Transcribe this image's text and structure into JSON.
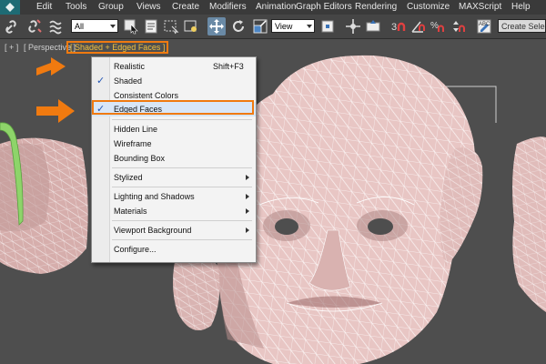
{
  "menubar": {
    "items": [
      "Edit",
      "Tools",
      "Group",
      "Views",
      "Create",
      "Modifiers",
      "Animation",
      "Graph Editors",
      "Rendering",
      "Customize",
      "MAXScript",
      "Help"
    ]
  },
  "toolbar": {
    "filter_value": "All",
    "view_value": "View",
    "search_placeholder": "Create Selection Set"
  },
  "viewport": {
    "label_plus": "[ + ]",
    "label_view": "[ Perspective ]",
    "label_shading": "[ Shaded + Edged Faces ]"
  },
  "context_menu": {
    "items": [
      {
        "label": "Realistic",
        "shortcut": "Shift+F3",
        "checked": false,
        "submenu": false
      },
      {
        "label": "Shaded",
        "shortcut": "",
        "checked": true,
        "submenu": false
      },
      {
        "label": "Consistent Colors",
        "shortcut": "",
        "checked": false,
        "submenu": false
      },
      {
        "label": "Edged Faces",
        "shortcut": "",
        "checked": true,
        "submenu": false
      },
      {
        "label": "Hidden Line",
        "shortcut": "",
        "checked": false,
        "submenu": false
      },
      {
        "label": "Wireframe",
        "shortcut": "",
        "checked": false,
        "submenu": false
      },
      {
        "label": "Bounding Box",
        "shortcut": "",
        "checked": false,
        "submenu": false
      },
      {
        "label": "Stylized",
        "shortcut": "",
        "checked": false,
        "submenu": true
      },
      {
        "label": "Lighting and Shadows",
        "shortcut": "",
        "checked": false,
        "submenu": true
      },
      {
        "label": "Materials",
        "shortcut": "",
        "checked": false,
        "submenu": true
      },
      {
        "label": "Viewport Background",
        "shortcut": "",
        "checked": false,
        "submenu": true
      },
      {
        "label": "Configure...",
        "shortcut": "",
        "checked": false,
        "submenu": false
      }
    ]
  },
  "colors": {
    "accent_orange": "#f07a10",
    "check_blue": "#2457b6",
    "skin": "#e8c6c4",
    "wire": "#ffffff"
  }
}
